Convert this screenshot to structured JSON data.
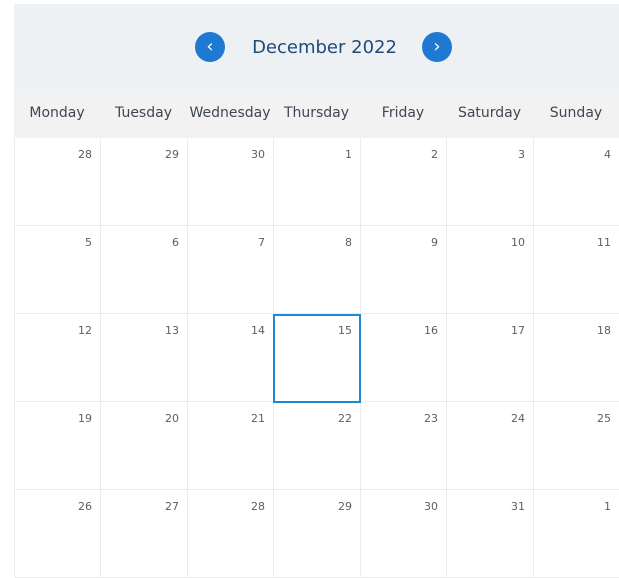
{
  "header": {
    "title": "December 2022",
    "prev_icon": "‹",
    "next_icon": "›",
    "prev_icon_name": "chevron-left-icon",
    "next_icon_name": "chevron-right-icon",
    "accent": "#1f78d1"
  },
  "weekdays": [
    "Monday",
    "Tuesday",
    "Wednesday",
    "Thursday",
    "Friday",
    "Saturday",
    "Sunday"
  ],
  "weeks": [
    [
      "28",
      "29",
      "30",
      "1",
      "2",
      "3",
      "4"
    ],
    [
      "5",
      "6",
      "7",
      "8",
      "9",
      "10",
      "11"
    ],
    [
      "12",
      "13",
      "14",
      "15",
      "16",
      "17",
      "18"
    ],
    [
      "19",
      "20",
      "21",
      "22",
      "23",
      "24",
      "25"
    ],
    [
      "26",
      "27",
      "28",
      "29",
      "30",
      "31",
      "1"
    ]
  ],
  "selected_day": "15",
  "colors": {
    "header_bg": "#eef1f4",
    "weekday_bg": "#f2f2f2",
    "selection_border": "#1c8ad6"
  }
}
